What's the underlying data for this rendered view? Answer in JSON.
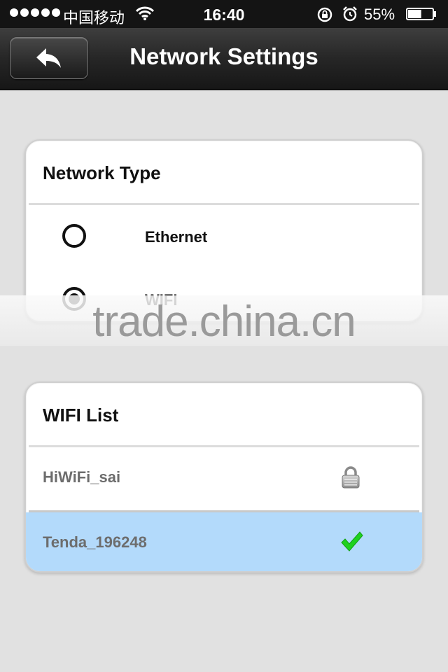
{
  "status_bar": {
    "carrier": "中国移动",
    "time": "16:40",
    "battery_percent": "55%",
    "battery_level": 0.55,
    "icons": [
      "signal-dots-icon",
      "wifi-icon",
      "rotation-lock-icon",
      "alarm-icon",
      "battery-icon"
    ]
  },
  "nav": {
    "back_icon": "back-arrow-icon",
    "title": "Network Settings"
  },
  "network_type": {
    "title": "Network Type",
    "options": [
      {
        "label": "Ethernet",
        "selected": false
      },
      {
        "label": "WIFI",
        "selected": true
      }
    ]
  },
  "wifi_list": {
    "title": "WIFI List",
    "networks": [
      {
        "name": "HiWiFi_sai",
        "icon": "lock-icon",
        "selected": false
      },
      {
        "name": "Tenda_196248",
        "icon": "check-icon",
        "selected": true
      }
    ]
  },
  "watermark": "trade.china.cn",
  "colors": {
    "selected_row": "#b3dafb",
    "check_green": "#1fd11f",
    "background": "#e1e1e1"
  }
}
